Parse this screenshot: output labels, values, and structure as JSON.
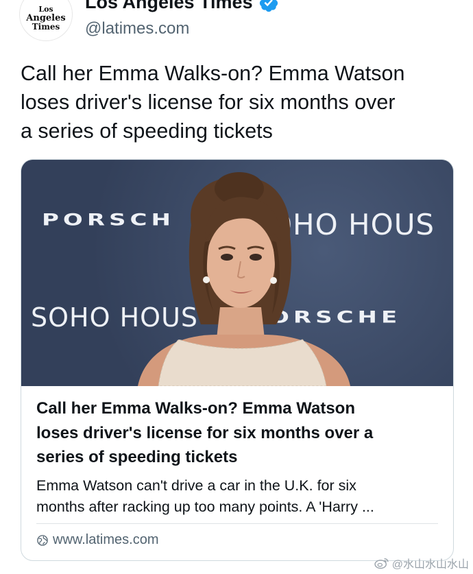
{
  "author": {
    "avatar_lines": [
      "Los",
      "Angeles",
      "Times"
    ],
    "display_name": "Los Angeles Times",
    "handle": "@latimes.com",
    "verified_icon": "verified-badge-icon"
  },
  "tweet": {
    "text_lines": [
      "Call her Emma Walks-on? Emma Watson",
      "loses driver's license for six months over",
      "a series of speeding tickets"
    ]
  },
  "card": {
    "image_backdrop": {
      "porsche_1": "PORSCH",
      "soho_1": "OHO HOUS",
      "soho_2": "SOHO HOUS",
      "porsche_2": "ORSCHE"
    },
    "title_lines": [
      "Call her Emma Walks-on? Emma Watson",
      "loses driver's license for six months over a",
      "series of speeding tickets"
    ],
    "description_lines": [
      "Emma Watson can't drive a car in the U.K. for six",
      "months after racking up too many points. A 'Harry ..."
    ],
    "domain": "www.latimes.com",
    "domain_icon": "globe-icon"
  },
  "watermark": {
    "text": "@水山水山水山",
    "icon": "weibo-icon"
  },
  "colors": {
    "text_primary": "#0f1419",
    "text_secondary": "#536471",
    "verified_blue": "#1d9bf0",
    "card_border": "#cfd9de",
    "image_backdrop": "#3c4a63"
  }
}
